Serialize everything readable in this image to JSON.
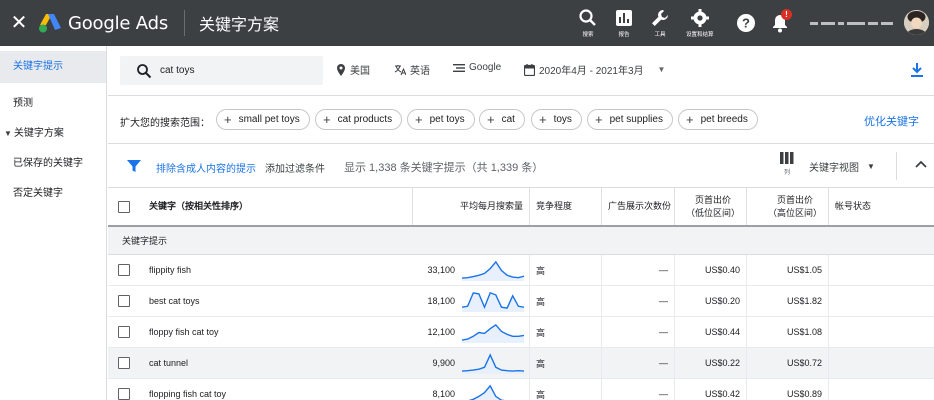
{
  "header": {
    "brand": "Google Ads",
    "page_title": "关键字方案",
    "tools": [
      {
        "icon": "search-icon",
        "label": "搜索"
      },
      {
        "icon": "reports-icon",
        "label": "报告"
      },
      {
        "icon": "wrench-icon",
        "label": "工具"
      },
      {
        "icon": "gear-icon",
        "label": "设置和结算"
      }
    ],
    "notification_badge": "!"
  },
  "sidebar": {
    "items": [
      {
        "label": "关键字提示",
        "active": true
      },
      {
        "label": "预测"
      },
      {
        "label": "关键字方案",
        "group": true
      },
      {
        "label": "已保存的关键字"
      },
      {
        "label": "否定关键字"
      }
    ]
  },
  "toolbar": {
    "search_value": "cat toys",
    "location": "美国",
    "language": "英语",
    "network": "Google",
    "date_range": "2020年4月 - 2021年3月"
  },
  "expand": {
    "label": "扩大您的搜索范围：",
    "chips": [
      "small pet toys",
      "cat products",
      "pet toys",
      "cat",
      "toys",
      "pet supplies",
      "pet breeds"
    ],
    "refine_label": "优化关键字"
  },
  "filterbar": {
    "exclude_adult": "排除含成人内容的提示",
    "add_filter": "添加过滤条件",
    "count_text": "显示 1,338 条关键字提示（共 1,339 条）",
    "columns_label": "列",
    "view_label": "关键字视图"
  },
  "table": {
    "headers": {
      "keyword": "关键字（按相关性排序）",
      "monthly": "平均每月搜索量",
      "competition": "竞争程度",
      "impression_share": "广告展示次数份",
      "bid_low": "页首出价\n（低位区间）",
      "bid_high": "页首出价\n（高位区间）",
      "account_status": "帐号状态"
    },
    "group_label": "关键字提示",
    "rows": [
      {
        "keyword": "flippity fish",
        "monthly": "33,100",
        "trend": [
          0.1,
          0.12,
          0.18,
          0.25,
          0.35,
          0.6,
          0.95,
          0.5,
          0.25,
          0.15,
          0.12,
          0.2
        ],
        "competition": "高",
        "impression": "—",
        "low": "US$0.40",
        "high": "US$1.05"
      },
      {
        "keyword": "best cat toys",
        "monthly": "18,100",
        "trend": [
          0.2,
          0.25,
          0.95,
          0.9,
          0.2,
          0.95,
          0.85,
          0.2,
          0.15,
          0.8,
          0.25,
          0.2
        ],
        "competition": "高",
        "impression": "—",
        "low": "US$0.20",
        "high": "US$1.82"
      },
      {
        "keyword": "floppy fish cat toy",
        "monthly": "12,100",
        "trend": [
          0.1,
          0.15,
          0.3,
          0.5,
          0.45,
          0.7,
          0.9,
          0.55,
          0.4,
          0.3,
          0.3,
          0.35
        ],
        "competition": "高",
        "impression": "—",
        "low": "US$0.44",
        "high": "US$1.08"
      },
      {
        "keyword": "cat tunnel",
        "monthly": "9,900",
        "trend": [
          0.1,
          0.12,
          0.15,
          0.2,
          0.3,
          0.95,
          0.3,
          0.15,
          0.12,
          0.1,
          0.12,
          0.1
        ],
        "competition": "高",
        "impression": "—",
        "low": "US$0.22",
        "high": "US$0.72"
      },
      {
        "keyword": "flopping fish cat toy",
        "monthly": "8,100",
        "trend": [
          0.1,
          0.15,
          0.25,
          0.4,
          0.6,
          0.95,
          0.4,
          0.2,
          0.15,
          0.12,
          0.12,
          0.1
        ],
        "competition": "高",
        "impression": "—",
        "low": "US$0.42",
        "high": "US$0.89"
      }
    ]
  },
  "colors": {
    "header_bg": "#3c4043",
    "link_blue": "#1a73e8",
    "spark_line": "#1a73e8",
    "spark_fill": "#e8f0fe"
  }
}
